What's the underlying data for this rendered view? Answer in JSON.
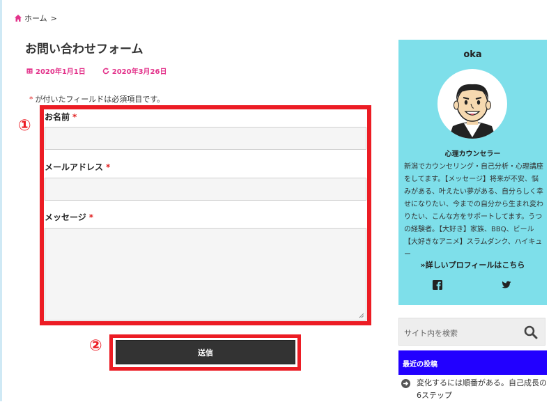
{
  "breadcrumb": {
    "home": "ホーム",
    "separator": ">"
  },
  "page": {
    "title": "お問い合わせフォーム",
    "published": "2020年1月1日",
    "updated": "2020年3月26日"
  },
  "form": {
    "required_note": "が付いたフィールドは必須項目です。",
    "required_mark": "*",
    "fields": {
      "name_label": "お名前",
      "email_label": "メールアドレス",
      "message_label": "メッセージ"
    },
    "submit_label": "送信"
  },
  "annotations": {
    "marker1": "①",
    "marker2": "②"
  },
  "profile": {
    "name": "oka",
    "role": "心理カウンセラー",
    "bio": "新潟でカウンセリング・自己分析・心理講座をしてます。【メッセージ】将来が不安、悩みがある、叶えたい夢がある、自分らしく幸せになりたい、今までの自分から生まれ変わりたい、こんな方をサポートしてます。うつの経験者。【大好き】家族、BBQ、ビール【大好きなアニメ】スラムダンク、ハイキュー",
    "more_link": "»詳しいプロフィールはこちら"
  },
  "search": {
    "placeholder": "サイト内を検索"
  },
  "recent": {
    "header": "最近の投稿",
    "items": [
      "変化するには順番がある。自己成長の6ステップ"
    ]
  },
  "colors": {
    "accent_pink": "#e3338b",
    "annotation_red": "#ec1c24",
    "profile_bg": "#7edfea",
    "recent_header_bg": "#2200ff",
    "button_bg": "#333333"
  },
  "icons": [
    "home-icon",
    "calendar-icon",
    "refresh-icon",
    "facebook-icon",
    "twitter-icon",
    "search-icon",
    "arrow-circle-icon",
    "resize-handle-icon"
  ]
}
